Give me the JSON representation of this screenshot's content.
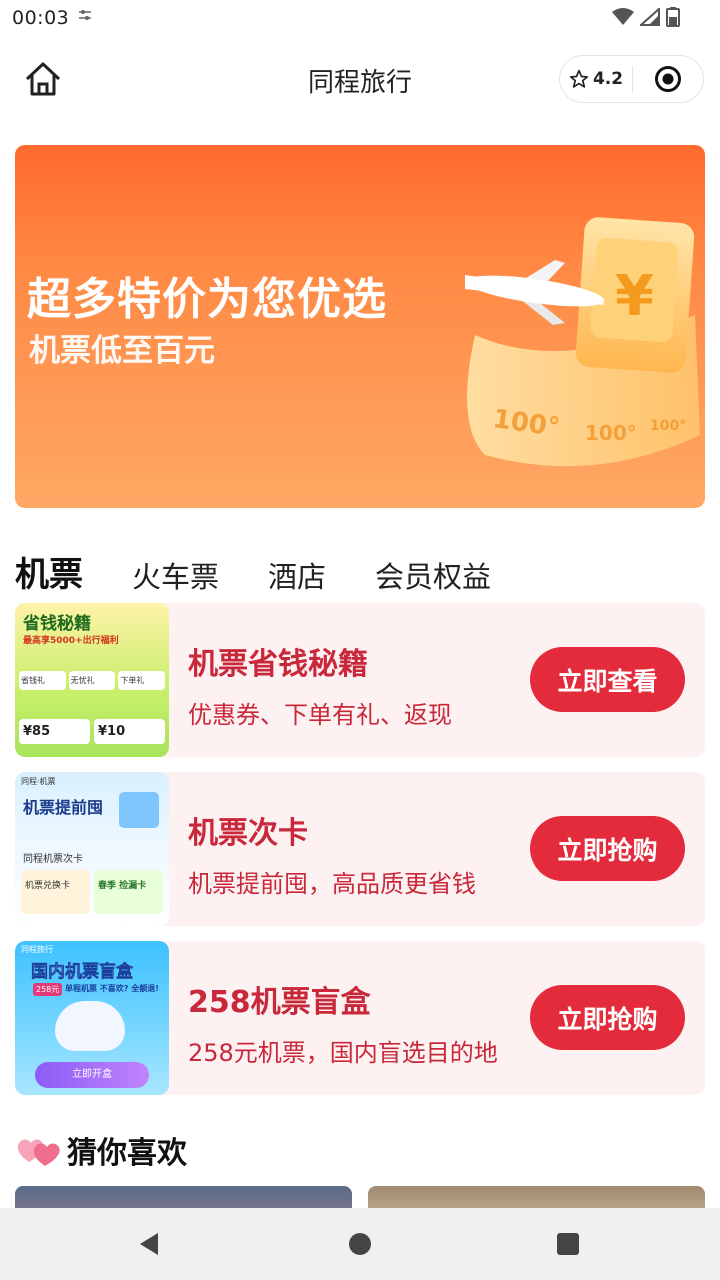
{
  "status_bar": {
    "time": "00:03",
    "extra_icon": "settings-sliders-icon"
  },
  "nav": {
    "title": "同程旅行",
    "rating": "4.2",
    "home_icon": "home-icon",
    "star_icon": "star-icon",
    "target_icon": "target-icon"
  },
  "banner": {
    "title": "超多特价为您优选",
    "subtitle": "机票低至百元",
    "art_labels": [
      "100",
      "100",
      "100"
    ]
  },
  "tabs": [
    {
      "label": "机票",
      "active": true
    },
    {
      "label": "火车票",
      "active": false
    },
    {
      "label": "酒店",
      "active": false
    },
    {
      "label": "会员权益",
      "active": false
    }
  ],
  "cards": [
    {
      "title": "机票省钱秘籍",
      "desc": "优惠券、下单有礼、返现",
      "button": "立即查看",
      "thumb": {
        "heading": "省钱秘籍",
        "sub": "最高享5000+出行福利",
        "items": [
          "省钱礼",
          "无忧礼",
          "下单礼"
        ],
        "prices": [
          "¥85",
          "¥10"
        ]
      }
    },
    {
      "title": "机票次卡",
      "desc": "机票提前囤，高品质更省钱",
      "button": "立即抢购",
      "thumb": {
        "brand": "同程·机票",
        "heading": "机票提前囤",
        "sub": "同程机票次卡",
        "items": [
          "机票兑换卡",
          "春季 捡漏卡"
        ]
      }
    },
    {
      "title": "258机票盲盒",
      "desc": "258元机票，国内盲选目的地",
      "button": "立即抢购",
      "thumb": {
        "brand": "同程旅行",
        "heading": "国内机票盲盒",
        "sub": "单程机票 不喜欢? 全额退!",
        "tag": "258元",
        "cta": "立即开盒"
      }
    }
  ],
  "guess": {
    "title": "猜你喜欢",
    "icon": "hearts-icon"
  },
  "colors": {
    "accent_red": "#e32b3b",
    "banner_orange": "#ff6a2e",
    "tab_green": "#2ed27a",
    "card_bg": "#fdf1f2"
  }
}
